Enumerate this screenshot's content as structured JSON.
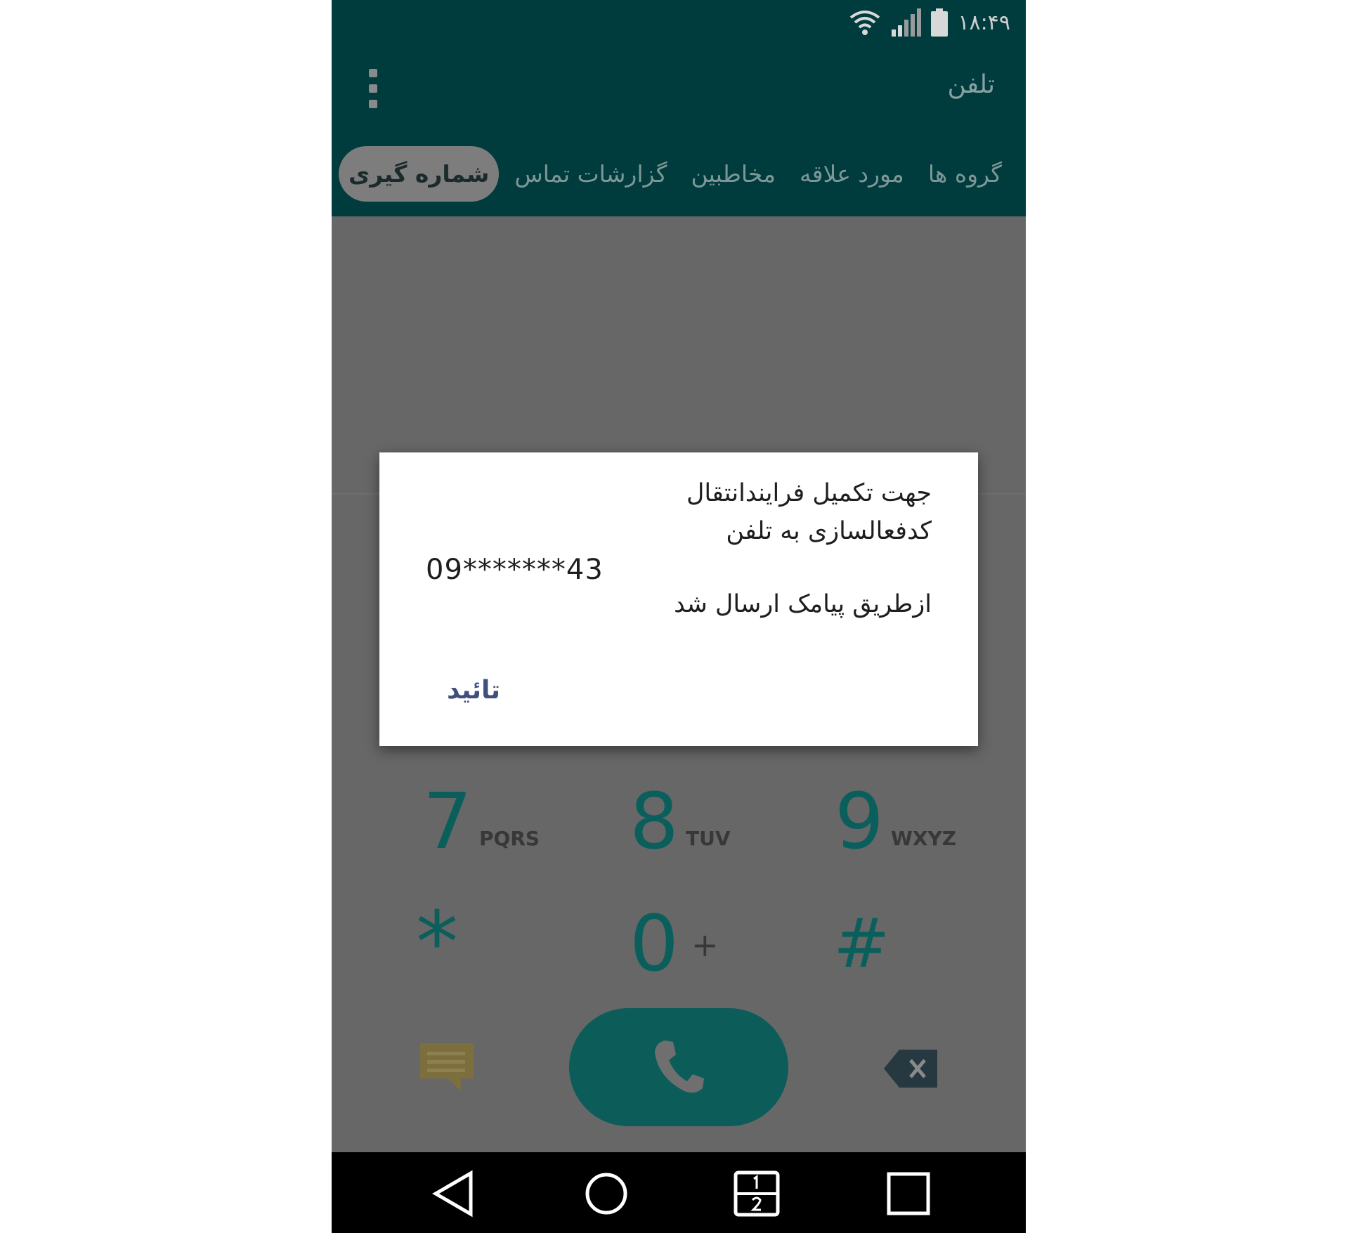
{
  "status": {
    "time": "۱۸:۴۹"
  },
  "appbar": {
    "title": "تلفن"
  },
  "tabs": [
    {
      "label": "گروه ها"
    },
    {
      "label": "مورد علاقه"
    },
    {
      "label": "مخاطبین"
    },
    {
      "label": "گزارشات تماس"
    },
    {
      "label": "شماره گیری"
    }
  ],
  "keypad": {
    "keys": [
      {
        "digit": "7",
        "letters": "PQRS"
      },
      {
        "digit": "8",
        "letters": "TUV"
      },
      {
        "digit": "9",
        "letters": "WXYZ"
      },
      {
        "digit": "*",
        "letters": ""
      },
      {
        "digit": "0",
        "letters": "+"
      },
      {
        "digit": "#",
        "letters": ""
      }
    ]
  },
  "dialog": {
    "line1": "جهت تکمیل فرایندانتقال",
    "line2": "کدفعالسازی به تلفن",
    "number": "09*******43",
    "line3": "ازطریق پیامک ارسال شد",
    "ok_label": "تائید"
  },
  "icons": {
    "menu": "overflow-menu-icon",
    "call": "phone-icon",
    "message": "message-icon",
    "backspace": "backspace-icon",
    "back": "back-icon",
    "home": "home-icon",
    "dual": "dual-window-icon",
    "recents": "recents-icon"
  },
  "colors": {
    "header": "#003c3d",
    "dim": "#676767",
    "accent": "#0c5c5a",
    "ok_button": "#3f4f7e"
  }
}
